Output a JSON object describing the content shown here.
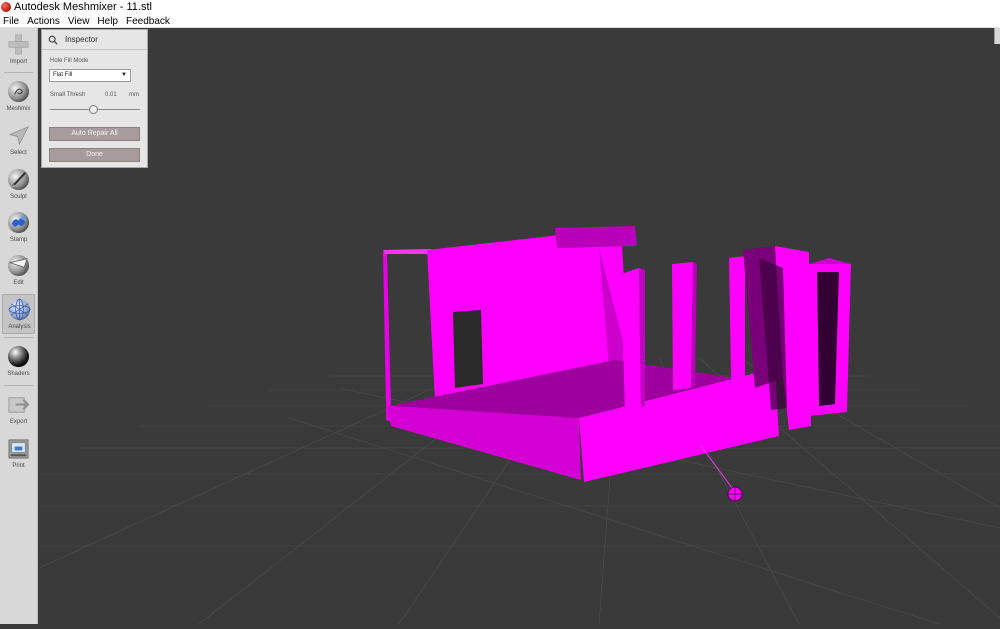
{
  "window": {
    "title": "Autodesk Meshmixer - 11.stl"
  },
  "menu": [
    {
      "label": "File"
    },
    {
      "label": "Actions"
    },
    {
      "label": "View"
    },
    {
      "label": "Help"
    },
    {
      "label": "Feedback"
    }
  ],
  "toolbar": {
    "items": [
      {
        "label": "Import",
        "icon": "plus-icon"
      },
      {
        "label": "Meshmix",
        "icon": "meshmix-icon"
      },
      {
        "label": "Select",
        "icon": "select-arrow-icon"
      },
      {
        "label": "Sculpt",
        "icon": "brush-icon"
      },
      {
        "label": "Stamp",
        "icon": "stamp-icon"
      },
      {
        "label": "Edit",
        "icon": "edit-sphere-icon"
      },
      {
        "label": "Analysis",
        "icon": "analysis-sphere-icon",
        "active": true
      },
      {
        "label": "Shaders",
        "icon": "shader-sphere-icon"
      },
      {
        "label": "Export",
        "icon": "export-icon"
      },
      {
        "label": "Print",
        "icon": "printer-icon"
      }
    ]
  },
  "inspector": {
    "title": "Inspector",
    "hole_fill_mode_label": "Hole Fill Mode",
    "hole_fill_mode_value": "Flat Fill",
    "small_thresh_label": "Small Thresh",
    "small_thresh_value": "0.01",
    "small_thresh_unit": "mm",
    "small_thresh_slider_fraction": 0.48,
    "auto_repair_label": "Auto Repair All",
    "done_label": "Done"
  },
  "colors": {
    "model": "#ff00ff",
    "viewport_bg": "#3a3a3a",
    "button": "#a79b9b"
  }
}
